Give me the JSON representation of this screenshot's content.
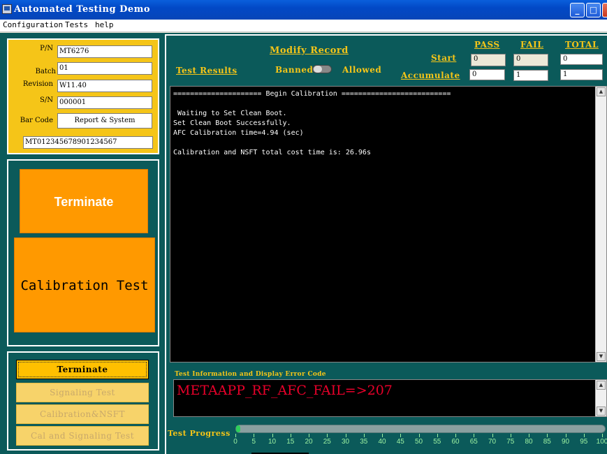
{
  "window": {
    "title": "Automated Testing Demo"
  },
  "menu": [
    "Configuration",
    "Tests",
    "help"
  ],
  "info": {
    "pn_label": "P/N",
    "pn": "MT6276",
    "batch_label": "Batch",
    "batch": "01",
    "revision_label": "Revision",
    "revision": "W11.40",
    "sn_label": "S/N",
    "sn": "000001",
    "barcode_label": "Bar Code",
    "report_button": "Report & System",
    "barcode": "MT012345678901234567"
  },
  "buttons": {
    "terminate_big": "Terminate",
    "calibration_big": "Calibration Test",
    "terminate_small": "Terminate",
    "signaling": "Signaling Test",
    "cal_nsft": "Calibration&NSFT",
    "cal_signaling": "Cal and Signaling Test"
  },
  "header": {
    "modify_record": "Modify Record",
    "test_results": "Test Results",
    "banned": "Banned",
    "allowed": "Allowed",
    "start": "Start",
    "accumulate": "Accumulate",
    "pass": "PASS",
    "fail": "FAIL",
    "total": "TOTAL"
  },
  "counts": {
    "start_pass": "0",
    "start_fail": "0",
    "start_total": "0",
    "acc_pass": "0",
    "acc_fail": "1",
    "acc_total": "1"
  },
  "console": "===================== Begin Calibration ==========================\n\n Waiting to Set Clean Boot.\nSet Clean Boot Successfully.\nAFC Calibration time=4.94 (sec)\n\nCalibration and NSFT total cost time is: 26.96s",
  "error": {
    "label": "Test Information and Display Error Code",
    "message": "METAAPP_RF_AFC_FAIL=>207"
  },
  "progress": {
    "label": "Test Progress",
    "value": 0.01,
    "ticks": [
      "0",
      "5",
      "10",
      "15",
      "20",
      "25",
      "30",
      "35",
      "40",
      "45",
      "50",
      "55",
      "60",
      "65",
      "70",
      "75",
      "80",
      "85",
      "90",
      "95",
      "100"
    ]
  },
  "colors": {
    "background": "#0b5a5a",
    "accent": "#f5c518",
    "button": "#ff9900",
    "error": "#e8002a"
  }
}
